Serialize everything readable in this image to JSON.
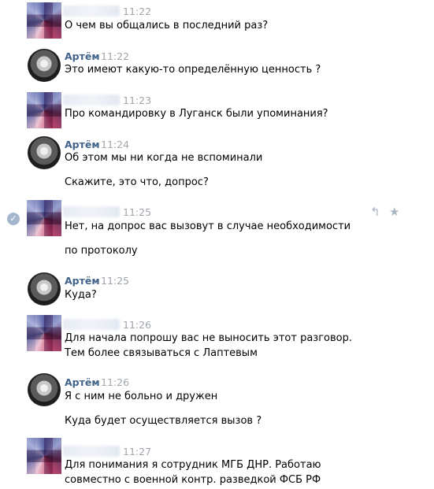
{
  "messages": [
    {
      "author": "",
      "time": "11:22",
      "lines": [
        "О чем вы общались в последний раз?"
      ]
    },
    {
      "author": "Артём",
      "time": "11:22",
      "lines": [
        "Это имеют какую-то определённую ценность ?"
      ]
    },
    {
      "author": "",
      "time": "11:23",
      "lines": [
        "Про командировку в Луганск были упоминания?"
      ]
    },
    {
      "author": "Артём",
      "time": "11:24",
      "lines": [
        "Об этом мы ни когда не вспоминали",
        "Скажите, это что, допрос?"
      ]
    },
    {
      "author": "",
      "time": "11:25",
      "lines": [
        "Нет, на допрос вас вызовут в случае необходимости",
        "по протоколу"
      ]
    },
    {
      "author": "Артём",
      "time": "11:25",
      "lines": [
        "Куда?"
      ]
    },
    {
      "author": "",
      "time": "11:26",
      "lines": [
        "Для начала попрошу вас не выносить этот разговор. Тем более связываться с Лаптевым"
      ]
    },
    {
      "author": "Артём",
      "time": "11:26",
      "lines": [
        "Я с ним не больно и дружен",
        "Куда будет осуществляется вызов ?"
      ]
    },
    {
      "author": "",
      "time": "11:27",
      "lines": [
        "Для понимания я сотрудник МГБ ДНР. Работаю совместно с военной контр. разведкой ФСБ РФ"
      ]
    }
  ],
  "icons": {
    "selected": "check-icon",
    "reply": "reply-icon",
    "favorite": "star-icon"
  },
  "colors": {
    "author": "#42648b",
    "time": "#a0a6ad",
    "action": "#aab4c1"
  }
}
